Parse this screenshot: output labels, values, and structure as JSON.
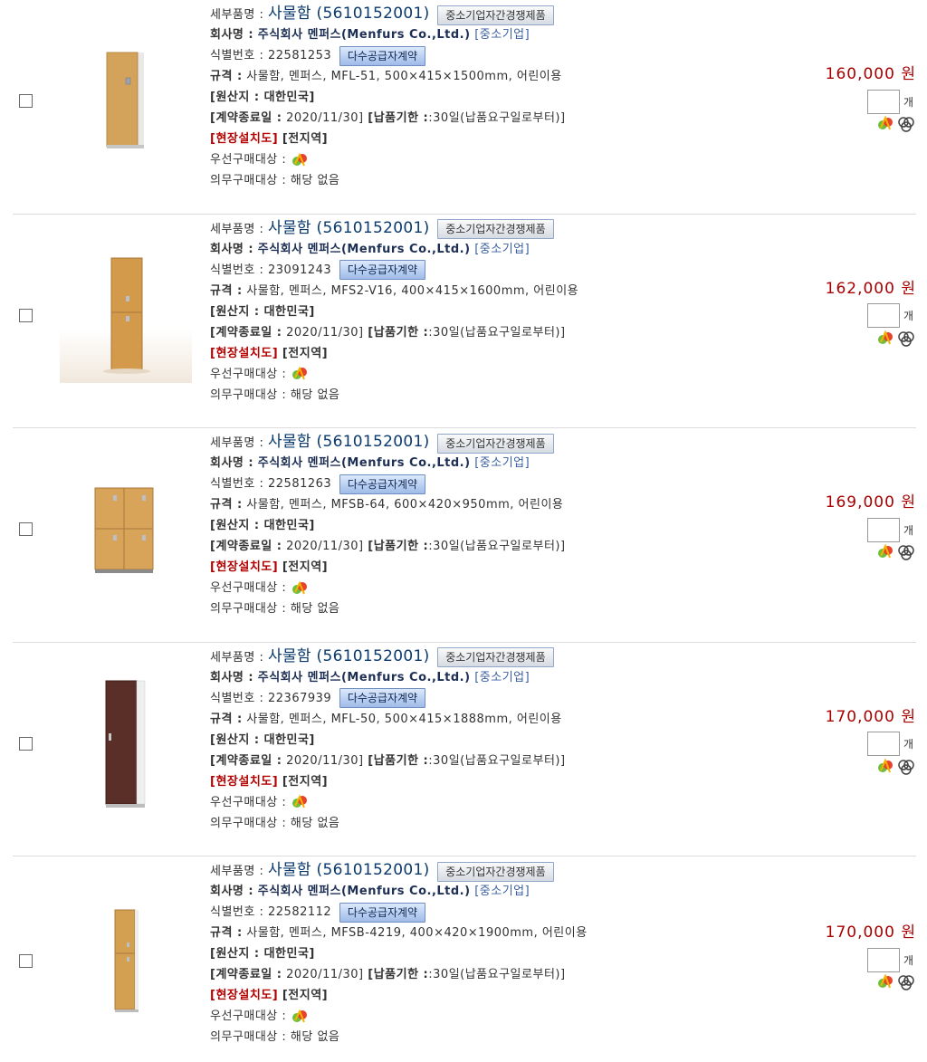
{
  "labels": {
    "detail_name": "세부품명 :",
    "company": "회사명 :",
    "id_no": "식별번호 :",
    "spec": "규격 :",
    "origin": "[원산지 : 대한민국]",
    "contract_end_label": "[계약종료일 :",
    "delivery_label": "[납품기한 :",
    "install": "[현장설치도]",
    "region": "[전지역]",
    "priority": "우선구매대상 :",
    "mandatory": "의무구매대상 : 해당 없음",
    "unit": "개",
    "won": "원",
    "badge_competition": "중소기업자간경쟁제품",
    "badge_mas": "다수공급자계약",
    "smb": "[중소기업]"
  },
  "colors": {
    "price": "#a80000",
    "product_name": "#0a3a6e",
    "install_red": "#b30000"
  },
  "products": [
    {
      "name": "사물함 (5610152001)",
      "company": "주식회사 멘퍼스(Menfurs Co.,Ltd.)",
      "id": "22581253",
      "spec": "사물함, 멘퍼스, MFL-51, 500×415×1500mm, 어린이용",
      "contract_end": "2020/11/30]",
      "delivery": ":30일(납품요구일로부터)]",
      "price": "160,000",
      "image": "single-locker-tall-wood"
    },
    {
      "name": "사물함 (5610152001)",
      "company": "주식회사 멘퍼스(Menfurs Co.,Ltd.)",
      "id": "23091243",
      "spec": "사물함, 멘퍼스, MFS2-V16, 400×415×1600mm, 어린이용",
      "contract_end": "2020/11/30]",
      "delivery": ":30일(납품요구일로부터)]",
      "price": "162,000",
      "image": "two-door-locker-wood"
    },
    {
      "name": "사물함 (5610152001)",
      "company": "주식회사 멘퍼스(Menfurs Co.,Ltd.)",
      "id": "22581263",
      "spec": "사물함, 멘퍼스, MFSB-64, 600×420×950mm, 어린이용",
      "contract_end": "2020/11/30]",
      "delivery": ":30일(납품요구일로부터)]",
      "price": "169,000",
      "image": "four-door-locker-wood"
    },
    {
      "name": "사물함 (5610152001)",
      "company": "주식회사 멘퍼스(Menfurs Co.,Ltd.)",
      "id": "22367939",
      "spec": "사물함, 멘퍼스, MFL-50, 500×415×1888mm, 어린이용",
      "contract_end": "2020/11/30]",
      "delivery": ":30일(납품요구일로부터)]",
      "price": "170,000",
      "image": "single-locker-tall-walnut"
    },
    {
      "name": "사물함 (5610152001)",
      "company": "주식회사 멘퍼스(Menfurs Co.,Ltd.)",
      "id": "22582112",
      "spec": "사물함, 멘퍼스, MFSB-4219, 400×420×1900mm, 어린이용",
      "contract_end": "2020/11/30]",
      "delivery": ":30일(납품요구일로부터)]",
      "price": "170,000",
      "image": "two-door-locker-slim-wood"
    }
  ]
}
